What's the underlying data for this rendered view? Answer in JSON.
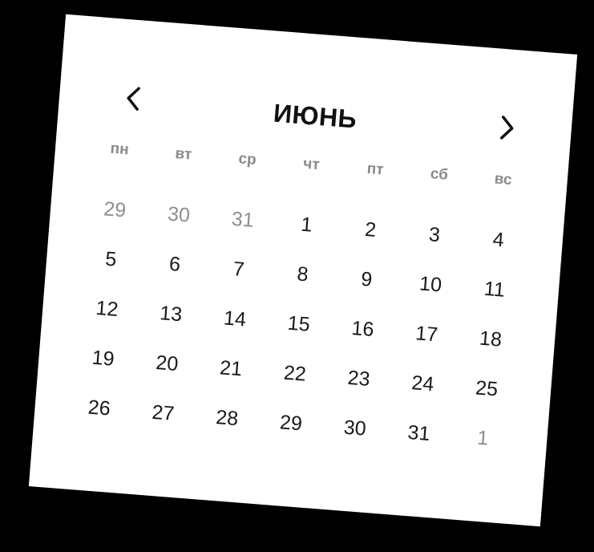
{
  "calendar": {
    "month_title": "ИЮНЬ",
    "prev_icon": "chevron-left-icon",
    "next_icon": "chevron-right-icon",
    "weekdays": [
      "пн",
      "вт",
      "ср",
      "чт",
      "пт",
      "сб",
      "вс"
    ],
    "weeks": [
      [
        {
          "d": "29",
          "muted": true
        },
        {
          "d": "30",
          "muted": true
        },
        {
          "d": "31",
          "muted": true
        },
        {
          "d": "1"
        },
        {
          "d": "2"
        },
        {
          "d": "3"
        },
        {
          "d": "4"
        }
      ],
      [
        {
          "d": "5"
        },
        {
          "d": "6"
        },
        {
          "d": "7"
        },
        {
          "d": "8"
        },
        {
          "d": "9"
        },
        {
          "d": "10"
        },
        {
          "d": "11"
        }
      ],
      [
        {
          "d": "12"
        },
        {
          "d": "13"
        },
        {
          "d": "14"
        },
        {
          "d": "15"
        },
        {
          "d": "16"
        },
        {
          "d": "17"
        },
        {
          "d": "18"
        }
      ],
      [
        {
          "d": "19"
        },
        {
          "d": "20"
        },
        {
          "d": "21"
        },
        {
          "d": "22"
        },
        {
          "d": "23"
        },
        {
          "d": "24"
        },
        {
          "d": "25"
        }
      ],
      [
        {
          "d": "26"
        },
        {
          "d": "27"
        },
        {
          "d": "28"
        },
        {
          "d": "29"
        },
        {
          "d": "30"
        },
        {
          "d": "31"
        },
        {
          "d": "1",
          "muted": true
        }
      ]
    ],
    "colors": {
      "text": "#1a1a1a",
      "muted": "#8f8f8f",
      "weekday": "#8a8a8a",
      "background": "#ffffff"
    }
  }
}
